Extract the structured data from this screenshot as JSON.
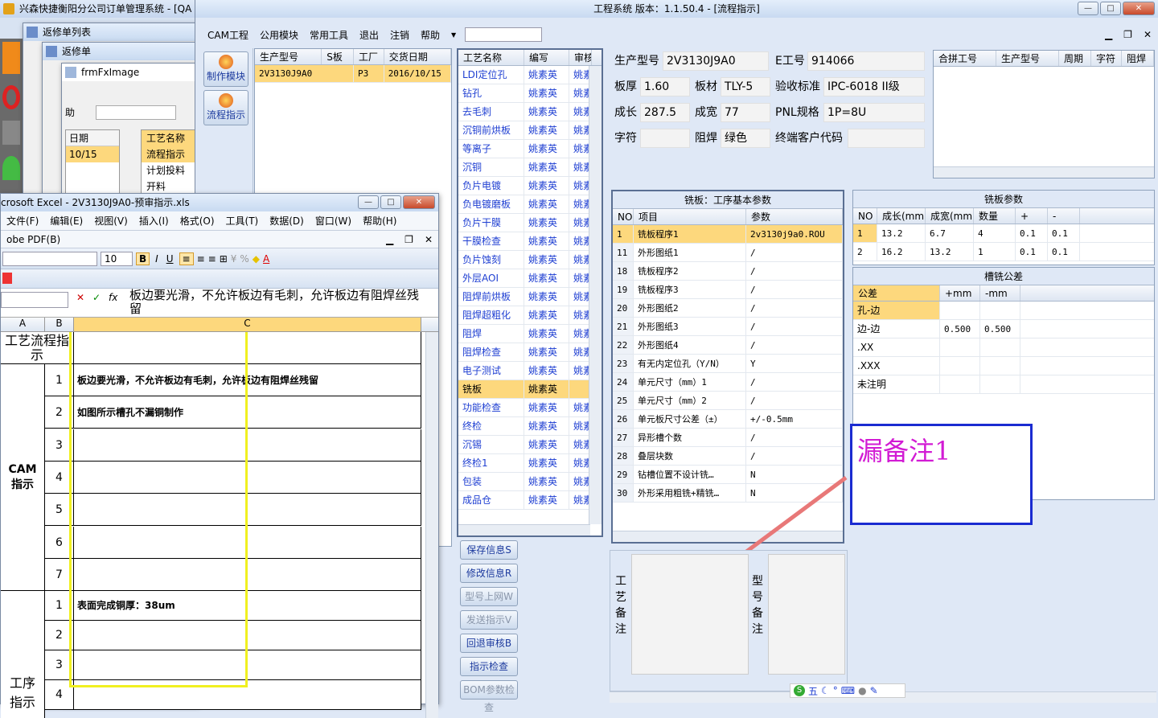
{
  "main_window": {
    "title": "工程系统   版本：1.1.50.4 - [流程指示]",
    "menu": [
      "CAM工程",
      "公用模块",
      "常用工具",
      "退出",
      "注销",
      "帮助"
    ],
    "side_buttons": [
      {
        "label": "制作模块"
      },
      {
        "label": "流程指示"
      }
    ]
  },
  "bg_window1": {
    "title": "兴森快捷衡阳分公司订单管理系统 - [QA"
  },
  "bg_window2": {
    "title": "返修单列表"
  },
  "bg_window3": {
    "title": "返修单"
  },
  "bg_window4": {
    "title": "frmFxImage",
    "menu_item": "助",
    "col_header1": "日期",
    "col_value1": "10/15",
    "col_header2": "工艺名称",
    "items": [
      "流程指示",
      "计划投料",
      "开料"
    ]
  },
  "order_grid": {
    "headers": [
      "生产型号",
      "S板",
      "工厂",
      "交货日期"
    ],
    "rows": [
      [
        "2V3130J9A0",
        "",
        "P3",
        "2016/10/15"
      ]
    ]
  },
  "process_grid": {
    "headers": [
      "工艺名称",
      "编写",
      "审核"
    ],
    "rows": [
      [
        "LDI定位孔",
        "姚素英",
        "姚素"
      ],
      [
        "钻孔",
        "姚素英",
        "姚素"
      ],
      [
        "去毛刺",
        "姚素英",
        "姚素"
      ],
      [
        "沉铜前烘板",
        "姚素英",
        "姚素"
      ],
      [
        "等离子",
        "姚素英",
        "姚素"
      ],
      [
        "沉铜",
        "姚素英",
        "姚素"
      ],
      [
        "负片电镀",
        "姚素英",
        "姚素"
      ],
      [
        "负电镀磨板",
        "姚素英",
        "姚素"
      ],
      [
        "负片干膜",
        "姚素英",
        "姚素"
      ],
      [
        "干膜检查",
        "姚素英",
        "姚素"
      ],
      [
        "负片蚀刻",
        "姚素英",
        "姚素"
      ],
      [
        "外层AOI",
        "姚素英",
        "姚素"
      ],
      [
        "阻焊前烘板",
        "姚素英",
        "姚素"
      ],
      [
        "阻焊超粗化",
        "姚素英",
        "姚素"
      ],
      [
        "阻焊",
        "姚素英",
        "姚素"
      ],
      [
        "阻焊检查",
        "姚素英",
        "姚素"
      ],
      [
        "电子测试",
        "姚素英",
        "姚素"
      ],
      [
        "铣板",
        "姚素英",
        ""
      ],
      [
        "功能检查",
        "姚素英",
        "姚素"
      ],
      [
        "终检",
        "姚素英",
        "姚素"
      ],
      [
        "沉锡",
        "姚素英",
        "姚素"
      ],
      [
        "终检1",
        "姚素英",
        "姚素"
      ],
      [
        "包装",
        "姚素英",
        "姚素"
      ],
      [
        "成品仓",
        "姚素英",
        "姚素"
      ]
    ],
    "selected_index": 17
  },
  "action_buttons": [
    "保存信息S",
    "修改信息R",
    "型号上网W",
    "发送指示V",
    "回退审核B",
    "指示检查",
    "BOM参数检查"
  ],
  "info": {
    "labels": {
      "prod": "生产型号",
      "eno": "E工号",
      "thick": "板厚",
      "mat": "板材",
      "std": "验收标准",
      "len": "成长",
      "wid": "成宽",
      "pnl": "PNL规格",
      "char": "字符",
      "mask": "阻焊",
      "cust": "终端客户代码"
    },
    "values": {
      "prod": "2V3130J9A0",
      "eno": "914066",
      "thick": "1.60",
      "mat": "TLY-5",
      "std": "IPC-6018 II级",
      "len": "287.5",
      "wid": "77",
      "pnl": "1P=8U",
      "char": "",
      "mask": "绿色",
      "cust": ""
    }
  },
  "merge_grid": {
    "headers": [
      "合拼工号",
      "生产型号",
      "周期",
      "字符",
      "阻焊"
    ]
  },
  "mill_params": {
    "title": "铣板：工序基本参数",
    "headers": [
      "NO",
      "项目",
      "参数"
    ],
    "rows": [
      [
        "1",
        "铣板程序1",
        "2v3130j9a0.ROU"
      ],
      [
        "11",
        "外形图纸1",
        "/"
      ],
      [
        "18",
        "铣板程序2",
        "/"
      ],
      [
        "19",
        "铣板程序3",
        "/"
      ],
      [
        "20",
        "外形图纸2",
        "/"
      ],
      [
        "21",
        "外形图纸3",
        "/"
      ],
      [
        "22",
        "外形图纸4",
        "/"
      ],
      [
        "23",
        "有无内定位孔（Y/N）",
        "Y"
      ],
      [
        "24",
        "单元尺寸（mm）1",
        "/"
      ],
      [
        "25",
        "单元尺寸（mm）2",
        "/"
      ],
      [
        "26",
        "单元板尺寸公差（±）",
        "+/-0.5mm"
      ],
      [
        "27",
        "异形槽个数",
        "/"
      ],
      [
        "28",
        "叠层块数",
        "/"
      ],
      [
        "29",
        "钻槽位置不设计铣…",
        "N"
      ],
      [
        "30",
        "外形采用粗铣+精铣…",
        "N"
      ]
    ]
  },
  "mill_board": {
    "title": "铣板参数",
    "headers": [
      "NO",
      "成长(mm)",
      "成宽(mm)",
      "数量",
      "+",
      "-"
    ],
    "rows": [
      [
        "1",
        "13.2",
        "6.7",
        "4",
        "0.1",
        "0.1"
      ],
      [
        "2",
        "16.2",
        "13.2",
        "1",
        "0.1",
        "0.1"
      ]
    ]
  },
  "slot_tol": {
    "title": "槽铣公差",
    "headers": [
      "公差",
      "+mm",
      "-mm"
    ],
    "rows": [
      [
        "孔-边",
        "",
        ""
      ],
      [
        "边-边",
        "0.500",
        "0.500"
      ],
      [
        ".XX",
        "",
        ""
      ],
      [
        ".XXX",
        "",
        ""
      ],
      [
        "未注明",
        "",
        ""
      ]
    ]
  },
  "annotation": "漏备注1",
  "remark_labels": {
    "process": "工艺备注",
    "model": "型号备注"
  },
  "excel": {
    "title": "crosoft Excel - 2V3130J9A0-预审指示.xls",
    "menu": [
      "文件(F)",
      "编辑(E)",
      "视图(V)",
      "插入(I)",
      "格式(O)",
      "工具(T)",
      "数据(D)",
      "窗口(W)",
      "帮助(H)"
    ],
    "menu2": "obe PDF(B)",
    "font_size": "10",
    "formula": "板边要光滑，不允许板边有毛刺，允许板边有阻焊丝残留",
    "cols": [
      "A",
      "B",
      "C"
    ],
    "header_cell": "工艺流程指示",
    "section_cam": "CAM指示",
    "section_proc": "工序指示",
    "rows_cam": [
      {
        "n": "1",
        "text": "板边要光滑，不允许板边有毛刺，允许板边有阻焊丝残留"
      },
      {
        "n": "2",
        "text": "如图所示槽孔不漏铜制作"
      },
      {
        "n": "3",
        "text": ""
      },
      {
        "n": "4",
        "text": ""
      },
      {
        "n": "5",
        "text": ""
      },
      {
        "n": "6",
        "text": ""
      },
      {
        "n": "7",
        "text": ""
      }
    ],
    "rows_proc": [
      {
        "n": "1",
        "text": "表面完成铜厚：38um"
      },
      {
        "n": "2",
        "text": ""
      },
      {
        "n": "3",
        "text": ""
      },
      {
        "n": "4",
        "text": ""
      }
    ]
  },
  "tray": {
    "ime": "五"
  }
}
